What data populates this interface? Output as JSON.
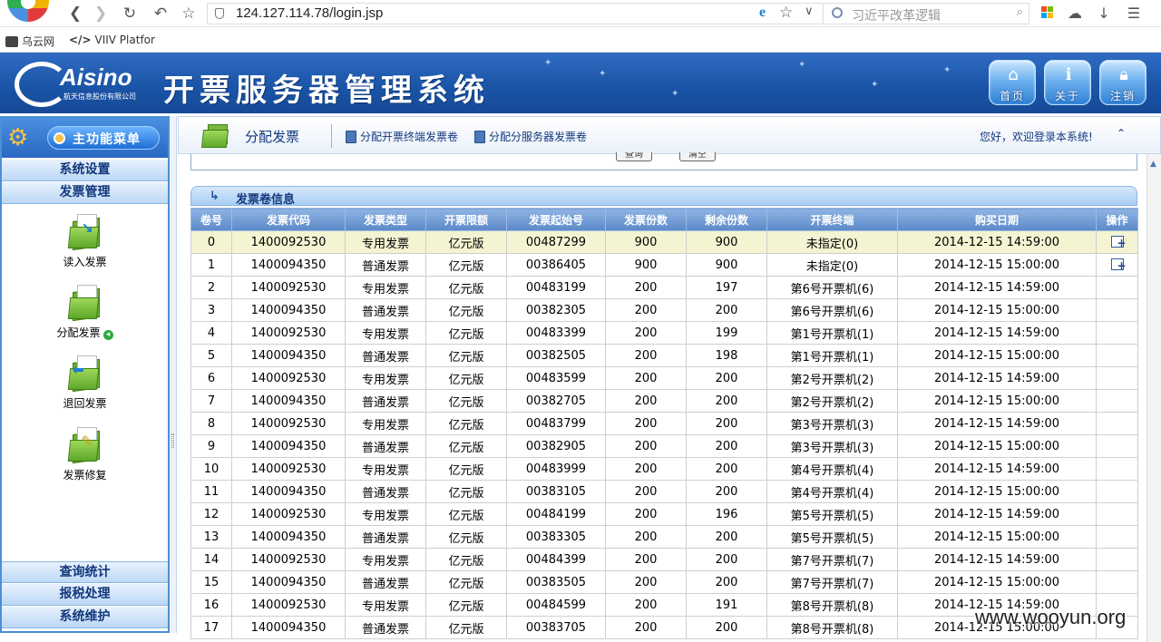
{
  "browser": {
    "url": "124.127.114.78/login.jsp",
    "search_placeholder": "习近平改革逻辑",
    "bookmarks": [
      {
        "label": "乌云网"
      },
      {
        "label": "VIIV Platfor",
        "prefix": "</>"
      }
    ]
  },
  "header": {
    "brand": "Aisino",
    "brand_sub": "航天信息股份有限公司",
    "title": "开票服务器管理系统",
    "buttons": [
      {
        "label": "首页",
        "icon": "home-icon"
      },
      {
        "label": "关于",
        "icon": "info-icon"
      },
      {
        "label": "注销",
        "icon": "lock-icon"
      }
    ]
  },
  "sidebar": {
    "menu_title": "主功能菜单",
    "top_sections": [
      "系统设置",
      "发票管理"
    ],
    "items": [
      {
        "label": "读入发票",
        "icon": "read-invoice-folder-icon"
      },
      {
        "label": "分配发票",
        "icon": "assign-invoice-folder-icon",
        "active": true
      },
      {
        "label": "退回发票",
        "icon": "return-invoice-folder-icon"
      },
      {
        "label": "发票修复",
        "icon": "repair-invoice-folder-icon"
      }
    ],
    "bottom_sections": [
      "查询统计",
      "报税处理",
      "系统维护"
    ]
  },
  "toolbar": {
    "title": "分配发票",
    "links": [
      "分配开票终端发票卷",
      "分配分服务器发票卷"
    ],
    "welcome": "您好，欢迎登录本系统!",
    "collapse": "⌃"
  },
  "query": {
    "buttons": [
      "查询",
      "清空"
    ]
  },
  "section": {
    "title": "发票卷信息"
  },
  "table": {
    "columns": [
      "卷号",
      "发票代码",
      "发票类型",
      "开票限额",
      "发票起始号",
      "发票份数",
      "剩余份数",
      "开票终端",
      "购买日期",
      "操作"
    ],
    "rows": [
      [
        "0",
        "1400092530",
        "专用发票",
        "亿元版",
        "00487299",
        "900",
        "900",
        "未指定(0)",
        "2014-12-15 14:59:00",
        "op"
      ],
      [
        "1",
        "1400094350",
        "普通发票",
        "亿元版",
        "00386405",
        "900",
        "900",
        "未指定(0)",
        "2014-12-15 15:00:00",
        "op"
      ],
      [
        "2",
        "1400092530",
        "专用发票",
        "亿元版",
        "00483199",
        "200",
        "197",
        "第6号开票机(6)",
        "2014-12-15 14:59:00",
        ""
      ],
      [
        "3",
        "1400094350",
        "普通发票",
        "亿元版",
        "00382305",
        "200",
        "200",
        "第6号开票机(6)",
        "2014-12-15 15:00:00",
        ""
      ],
      [
        "4",
        "1400092530",
        "专用发票",
        "亿元版",
        "00483399",
        "200",
        "199",
        "第1号开票机(1)",
        "2014-12-15 14:59:00",
        ""
      ],
      [
        "5",
        "1400094350",
        "普通发票",
        "亿元版",
        "00382505",
        "200",
        "198",
        "第1号开票机(1)",
        "2014-12-15 15:00:00",
        ""
      ],
      [
        "6",
        "1400092530",
        "专用发票",
        "亿元版",
        "00483599",
        "200",
        "200",
        "第2号开票机(2)",
        "2014-12-15 14:59:00",
        ""
      ],
      [
        "7",
        "1400094350",
        "普通发票",
        "亿元版",
        "00382705",
        "200",
        "200",
        "第2号开票机(2)",
        "2014-12-15 15:00:00",
        ""
      ],
      [
        "8",
        "1400092530",
        "专用发票",
        "亿元版",
        "00483799",
        "200",
        "200",
        "第3号开票机(3)",
        "2014-12-15 14:59:00",
        ""
      ],
      [
        "9",
        "1400094350",
        "普通发票",
        "亿元版",
        "00382905",
        "200",
        "200",
        "第3号开票机(3)",
        "2014-12-15 15:00:00",
        ""
      ],
      [
        "10",
        "1400092530",
        "专用发票",
        "亿元版",
        "00483999",
        "200",
        "200",
        "第4号开票机(4)",
        "2014-12-15 14:59:00",
        ""
      ],
      [
        "11",
        "1400094350",
        "普通发票",
        "亿元版",
        "00383105",
        "200",
        "200",
        "第4号开票机(4)",
        "2014-12-15 15:00:00",
        ""
      ],
      [
        "12",
        "1400092530",
        "专用发票",
        "亿元版",
        "00484199",
        "200",
        "196",
        "第5号开票机(5)",
        "2014-12-15 14:59:00",
        ""
      ],
      [
        "13",
        "1400094350",
        "普通发票",
        "亿元版",
        "00383305",
        "200",
        "200",
        "第5号开票机(5)",
        "2014-12-15 15:00:00",
        ""
      ],
      [
        "14",
        "1400092530",
        "专用发票",
        "亿元版",
        "00484399",
        "200",
        "200",
        "第7号开票机(7)",
        "2014-12-15 14:59:00",
        ""
      ],
      [
        "15",
        "1400094350",
        "普通发票",
        "亿元版",
        "00383505",
        "200",
        "200",
        "第7号开票机(7)",
        "2014-12-15 15:00:00",
        ""
      ],
      [
        "16",
        "1400092530",
        "专用发票",
        "亿元版",
        "00484599",
        "200",
        "191",
        "第8号开票机(8)",
        "2014-12-15 14:59:00",
        ""
      ],
      [
        "17",
        "1400094350",
        "普通发票",
        "亿元版",
        "00383705",
        "200",
        "200",
        "第8号开票机(8)",
        "2014-12-15 15:00:00",
        ""
      ]
    ],
    "highlight_row": 0
  },
  "watermark": "www.wooyun.org"
}
